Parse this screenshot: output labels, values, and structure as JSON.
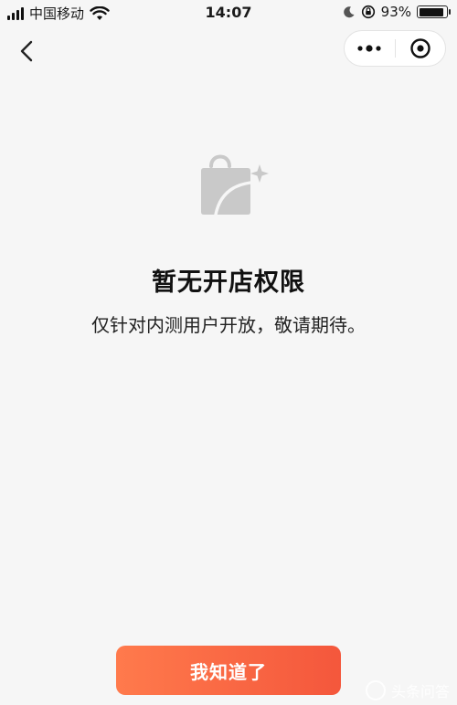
{
  "status_bar": {
    "carrier": "中国移动",
    "time": "14:07",
    "battery_percent": "93%",
    "battery_level": 0.93
  },
  "nav": {
    "back_icon": "chevron-left-icon",
    "more_icon": "more-dots-icon",
    "close_icon": "target-circle-icon"
  },
  "empty_state": {
    "icon": "shopping-bag-sparkle-icon",
    "title": "暂无开店权限",
    "description": "仅针对内测用户开放，敬请期待。"
  },
  "actions": {
    "confirm_label": "我知道了"
  },
  "watermark": {
    "text": "头条问答"
  },
  "colors": {
    "background": "#f6f6f6",
    "button_start": "#ff7a4c",
    "button_end": "#f4573c",
    "icon_gray": "#c9c9c9"
  }
}
